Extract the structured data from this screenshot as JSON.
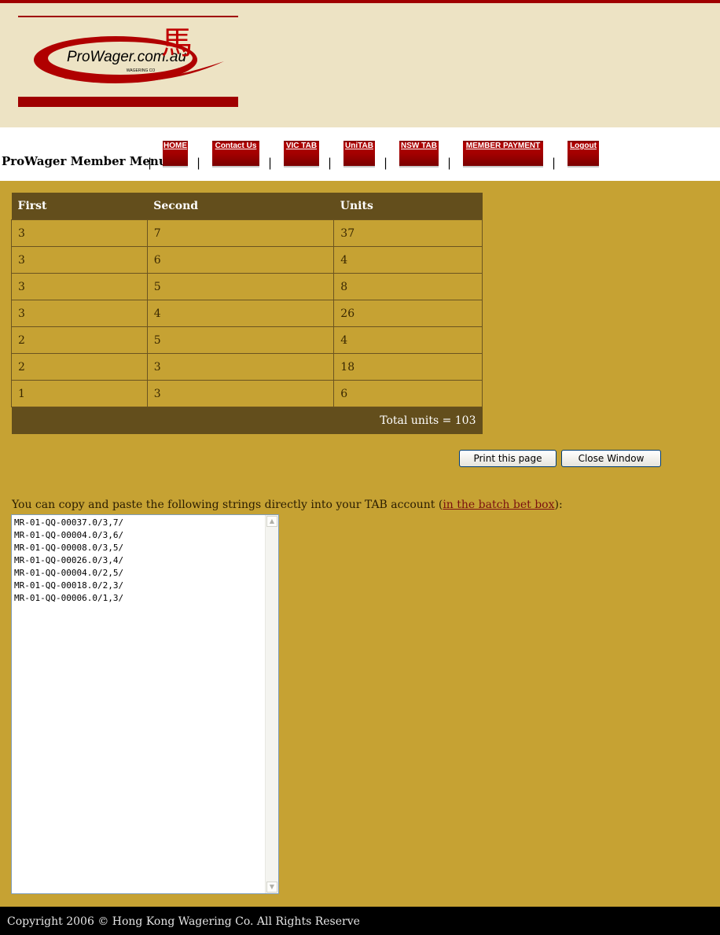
{
  "brand": {
    "logo_text": "ProWager.com.au",
    "logo_subtext": "WAGERING CO",
    "logo_glyph": "馬",
    "accent_color": "#a00000"
  },
  "nav": {
    "label": "ProWager Member Menu :",
    "items": [
      {
        "label": "HOME"
      },
      {
        "label": "Contact Us"
      },
      {
        "label": "VIC TAB"
      },
      {
        "label": "UniTAB"
      },
      {
        "label": "NSW TAB"
      },
      {
        "label": "MEMBER PAYMENT"
      },
      {
        "label": "Logout"
      }
    ],
    "separator": "|"
  },
  "table": {
    "headers": [
      "First",
      "Second",
      "Units"
    ],
    "rows": [
      [
        "3",
        "7",
        "37"
      ],
      [
        "3",
        "6",
        "4"
      ],
      [
        "3",
        "5",
        "8"
      ],
      [
        "3",
        "4",
        "26"
      ],
      [
        "2",
        "5",
        "4"
      ],
      [
        "2",
        "3",
        "18"
      ],
      [
        "1",
        "3",
        "6"
      ]
    ],
    "total": "Total units = 103"
  },
  "buttons": {
    "print": "Print this page",
    "close": "Close Window"
  },
  "copy": {
    "prefix": "You can copy and paste the following strings directly into your TAB account (",
    "link": "in the batch bet box",
    "suffix": "):"
  },
  "strings": [
    "MR-01-QQ-00037.0/3,7/",
    "MR-01-QQ-00004.0/3,6/",
    "MR-01-QQ-00008.0/3,5/",
    "MR-01-QQ-00026.0/3,4/",
    "MR-01-QQ-00004.0/2,5/",
    "MR-01-QQ-00018.0/2,3/",
    "MR-01-QQ-00006.0/1,3/"
  ],
  "footer": {
    "text": "Copyright 2006 © Hong Kong Wagering Co. All Rights Reserve"
  }
}
